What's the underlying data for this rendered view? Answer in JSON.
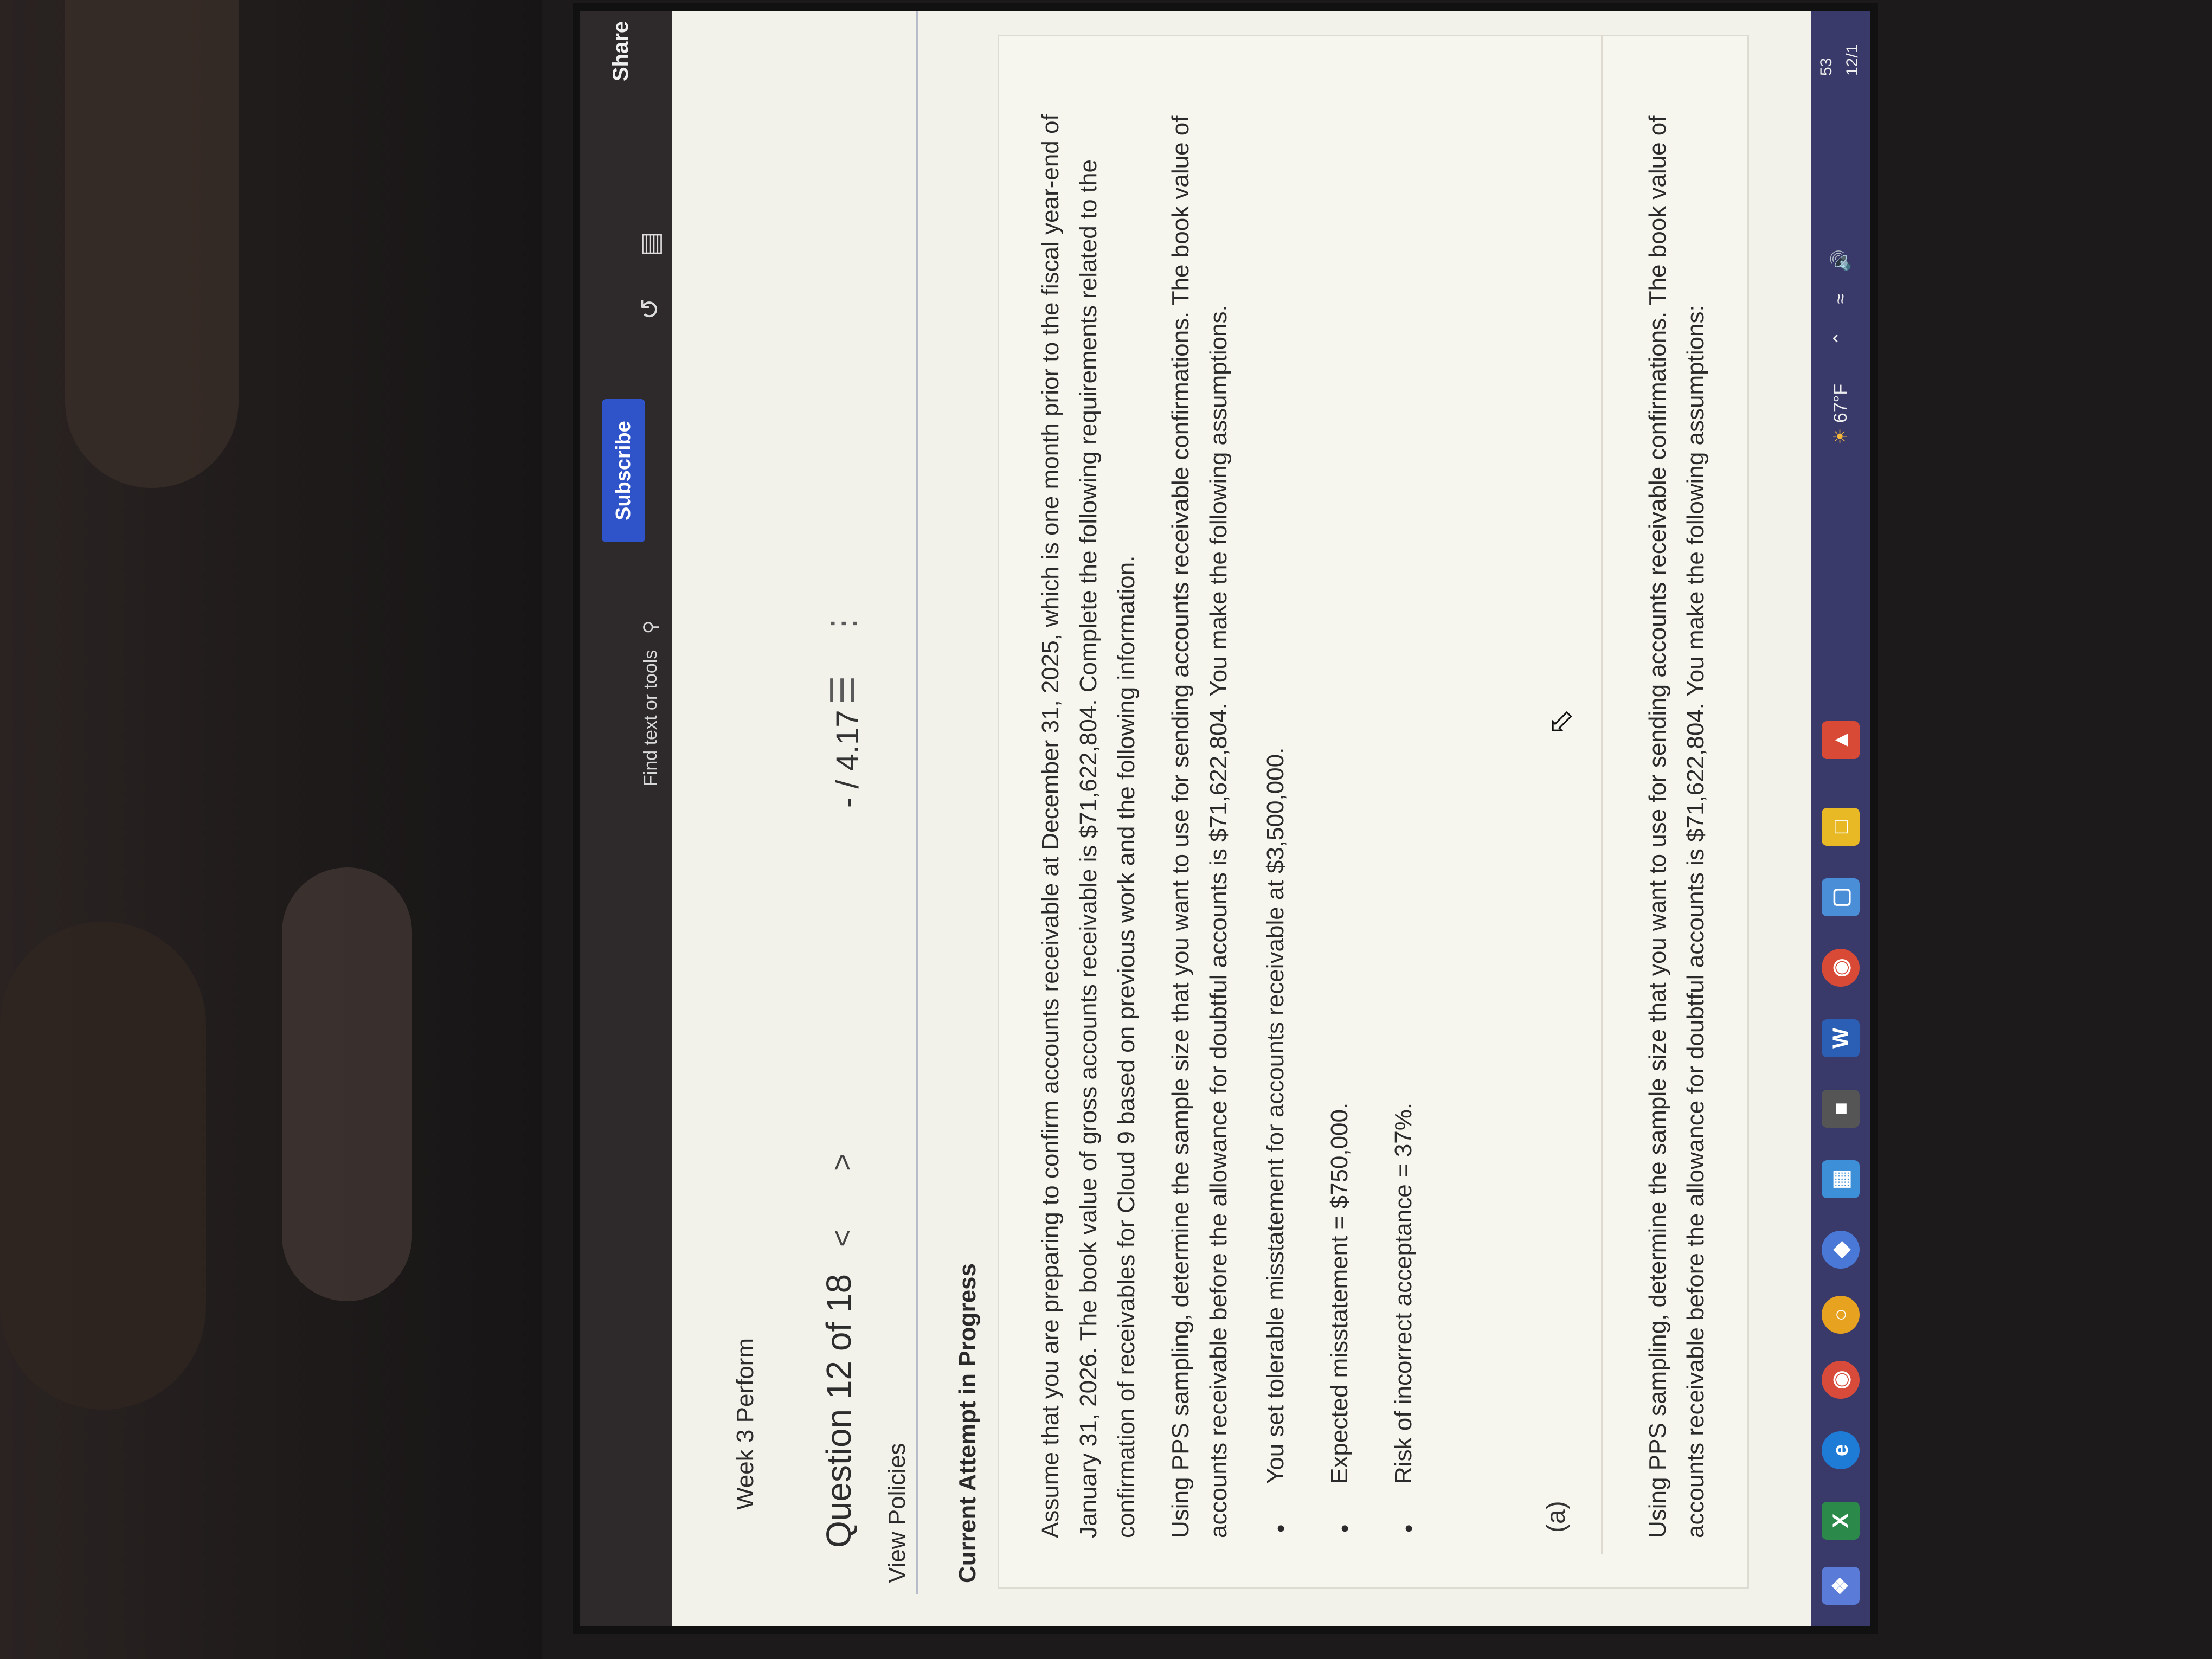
{
  "topbar": {
    "subscribe_label": "Subscribe",
    "find_placeholder": "Find text or tools",
    "share_label": "Share"
  },
  "page": {
    "course_title": "Week 3 Perform",
    "question_nav": "Question 12 of 18",
    "prev_glyph": "<",
    "next_glyph": ">",
    "points": "- / 4.17",
    "view_policies": "View Policies",
    "attempt_status": "Current Attempt in Progress"
  },
  "question": {
    "intro": "Assume that you are preparing to confirm accounts receivable at December 31, 2025, which is one month prior to the fiscal year-end of January 31, 2026. The book value of gross accounts receivable is $71,622,804. Complete the following requirements related to the confirmation of receivables for Cloud 9 based on previous work and the following information.",
    "pps_intro": "Using PPS sampling, determine the sample size that you want to use for sending accounts receivable confirmations. The book value of accounts receivable before the allowance for doubtful accounts is $71,622,804. You make the following assumptions.",
    "assumptions": [
      "You set tolerable misstatement for accounts receivable at $3,500,000.",
      "Expected misstatement = $750,000.",
      "Risk of incorrect acceptance = 37%."
    ],
    "part_label": "(a)",
    "part_a_text": "Using PPS sampling, determine the sample size that you want to use for sending accounts receivable confirmations. The book value of accounts receivable before the allowance for doubtful accounts is $71,622,804. You make the following assumptions:"
  },
  "taskbar": {
    "weather": "67°F",
    "clock_top": "53",
    "clock_bottom": "12/1"
  },
  "icons": [
    "search-icon",
    "list-icon",
    "more-icon",
    "share-icon",
    "windows-start-icon",
    "edge-icon",
    "chrome-icon",
    "word-icon",
    "excel-icon"
  ]
}
